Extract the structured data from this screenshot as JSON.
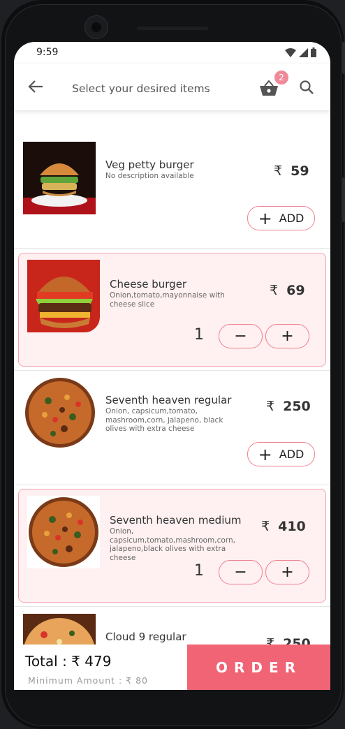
{
  "status_bar": {
    "time": "9:59"
  },
  "header": {
    "title": "Select your desired items",
    "cart_count": "2"
  },
  "currency_symbol": "₹",
  "items": [
    {
      "name": "Veg petty burger",
      "description": "No description available",
      "price": "59",
      "action_label": "ADD",
      "selected": false
    },
    {
      "name": "Cheese burger",
      "description": "Onion,tomato,mayonnaise with cheese slice",
      "price": "69",
      "quantity": "1",
      "selected": true
    },
    {
      "name": "Seventh heaven regular",
      "description": "Onion, capsicum,tomato, mashroom,corn, jalapeno, black olives with extra cheese",
      "price": "250",
      "action_label": "ADD",
      "selected": false
    },
    {
      "name": "Seventh heaven medium",
      "description": "Onion, capsicum,tomato,mashroom,corn, jalapeno,black olives with extra cheese",
      "price": "410",
      "quantity": "1",
      "selected": true
    },
    {
      "name": "Cloud 9 regular",
      "price": "250",
      "selected": false
    }
  ],
  "footer": {
    "total_label": "Total : ₹ 479",
    "minimum_label": "Minimum Amount : ₹ 80",
    "order_label": "ORDER"
  },
  "colors": {
    "accent": "#f06476",
    "selected_bg": "#fff0f1",
    "border": "#f07f8e",
    "badge": "#f08a98"
  }
}
